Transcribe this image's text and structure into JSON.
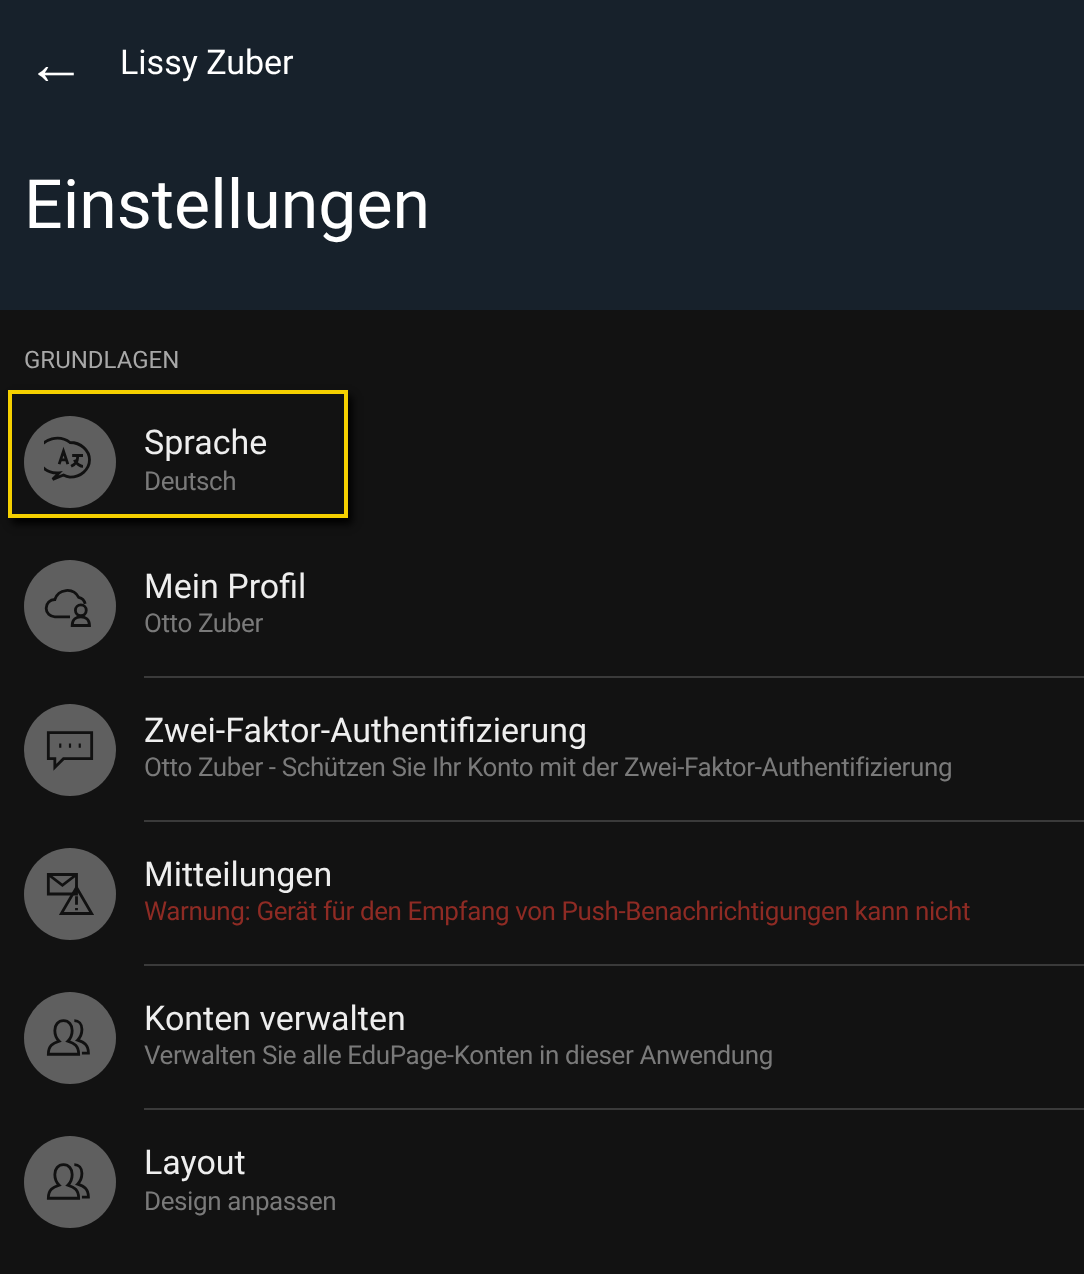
{
  "header": {
    "back_label": "←",
    "account": "Lissy Zuber",
    "title": "Einstellungen"
  },
  "section": {
    "title": "GRUNDLAGEN",
    "items": [
      {
        "kind": "language",
        "title": "Sprache",
        "subtitle": "Deutsch",
        "selected": true
      },
      {
        "kind": "cloud",
        "title": "Mein Profil",
        "subtitle": "Otto Zuber",
        "selected": false
      },
      {
        "kind": "chat",
        "title": "Zwei-Faktor-Authentifizierung",
        "subtitle": "Otto Zuber - Schützen Sie Ihr Konto mit der Zwei-Faktor-Authentifizierung",
        "selected": false
      },
      {
        "kind": "alert",
        "title": "Mitteilungen",
        "subtitle": "Warnung: Gerät für den Empfang von Push-Benachrichtigungen kann nicht",
        "selected": false
      },
      {
        "kind": "users",
        "title": "Konten verwalten",
        "subtitle": "Verwalten Sie alle EduPage-Konten in dieser Anwendung",
        "selected": false
      },
      {
        "kind": "users",
        "title": "Layout",
        "subtitle": "Design anpassen",
        "selected": false
      }
    ]
  }
}
